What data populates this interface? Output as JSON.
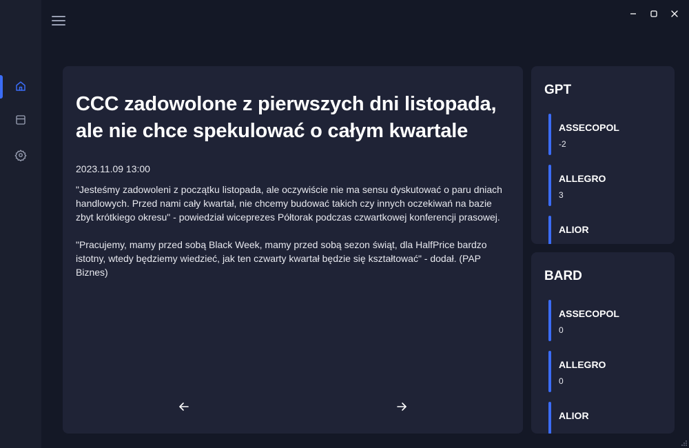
{
  "sidebar": {
    "items": [
      {
        "icon": "home-icon",
        "active": true
      },
      {
        "icon": "layout-icon",
        "active": false
      },
      {
        "icon": "settings-icon",
        "active": false
      }
    ],
    "accent_color": "#3b6cf5"
  },
  "header": {
    "menu_icon": "hamburger-icon",
    "window_controls": [
      "minimize-icon",
      "maximize-icon",
      "close-icon"
    ]
  },
  "article": {
    "title": "CCC zadowolone z pierwszych dni listopada, ale nie chce spekulować o całym kwartale",
    "date": "2023.11.09 13:00",
    "paragraphs": [
      "\"Jesteśmy zadowoleni z początku listopada, ale oczywiście nie ma sensu dyskutować o paru dniach handlowych. Przed nami cały kwartał, nie chcemy budować takich czy innych oczekiwań na bazie zbyt krótkiego okresu\" - powiedział wiceprezes Półtorak podczas czwartkowej konferencji prasowej.",
      "\"Pracujemy, mamy przed sobą Black Week, mamy przed sobą sezon świąt, dla HalfPrice bardzo istotny, wtedy będziemy wiedzieć, jak ten czwarty kwartał będzie się kształtować\" - dodał. (PAP Biznes)"
    ],
    "prev_icon": "arrow-left-icon",
    "next_icon": "arrow-right-icon"
  },
  "panels": {
    "gpt": {
      "title": "GPT",
      "items": [
        {
          "name": "ASSECOPOL",
          "value": "-2"
        },
        {
          "name": "ALLEGRO",
          "value": "3"
        },
        {
          "name": "ALIOR",
          "value": ""
        }
      ]
    },
    "bard": {
      "title": "BARD",
      "items": [
        {
          "name": "ASSECOPOL",
          "value": "0"
        },
        {
          "name": "ALLEGRO",
          "value": "0"
        },
        {
          "name": "ALIOR",
          "value": ""
        }
      ]
    }
  }
}
